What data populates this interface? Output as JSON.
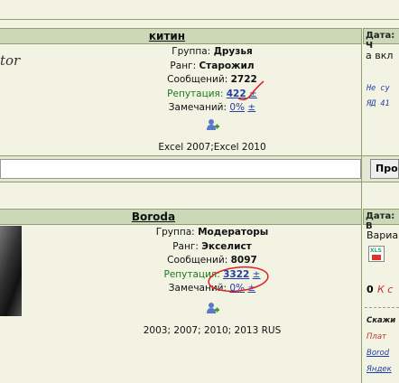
{
  "post1": {
    "username": "китин",
    "date_label": "Дата: Ч",
    "group_label": "Группа:",
    "group_value": "Друзья",
    "rank_label": "Ранг:",
    "rank_value": "Старожил",
    "messages_label": "Сообщений:",
    "messages_value": "2722",
    "reputation_label": "Репутация:",
    "reputation_value": "422",
    "plusminus": "±",
    "warnings_label": "Замечаний:",
    "warnings_value": "0%",
    "excel_versions": "Excel 2007;Excel 2010",
    "avatar_text": "tor",
    "right_line1": "а вкл",
    "right_italic1": "Не су",
    "right_italic2": "ЯД 41",
    "right_button": "Про"
  },
  "post2": {
    "username": "Boroda",
    "date_label": "Дата: В",
    "group_label": "Группа:",
    "group_value": "Модераторы",
    "rank_label": "Ранг:",
    "rank_value": "Экселист",
    "messages_label": "Сообщений:",
    "messages_value": "8097",
    "reputation_label": "Репутация:",
    "reputation_value": "3322",
    "plusminus": "±",
    "warnings_label": "Замечаний:",
    "warnings_value": "0%",
    "excel_versions": "2003; 2007; 2010; 2013 RUS",
    "right_text1": "Вариа",
    "right_icon_label": "XLS",
    "right_zero": "0",
    "right_red": "К с",
    "sig_line1": "Скажи",
    "sig_line2": "Плат",
    "sig_line3": "Borod",
    "sig_line4": "Яндек"
  }
}
